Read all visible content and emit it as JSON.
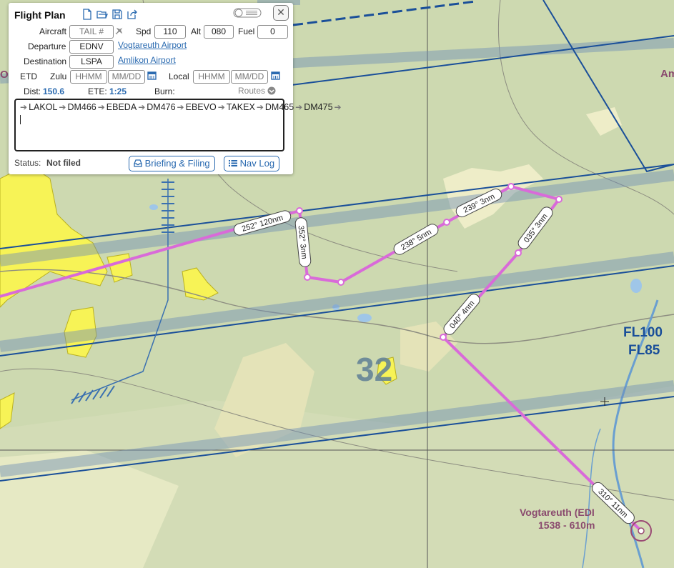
{
  "panel": {
    "title": "Flight Plan",
    "close_glyph": "✕",
    "aircraft_label": "Aircraft",
    "aircraft_placeholder": "TAIL #",
    "spd_label": "Spd",
    "spd_value": "110",
    "alt_label": "Alt",
    "alt_value": "080",
    "fuel_label": "Fuel",
    "fuel_value": "0",
    "departure_label": "Departure",
    "departure_code": "EDNV",
    "departure_name": "Vogtareuth Airport",
    "destination_label": "Destination",
    "destination_code": "LSPA",
    "destination_name": "Amlikon Airport",
    "etd_label": "ETD",
    "zulu_label": "Zulu",
    "time_placeholder": "HHMM",
    "date_placeholder": "MM/DD",
    "local_label": "Local",
    "dist_label": "Dist:",
    "dist_value": "150.6",
    "ete_label": "ETE:",
    "ete_value": "1:25",
    "burn_label": "Burn:",
    "routes_label": "Routes",
    "route_waypoints": [
      "LAKOL",
      "DM466",
      "EBEDA",
      "DM476",
      "EBEVO",
      "TAKEX",
      "DM465",
      "DM475"
    ],
    "status_label": "Status:",
    "status_value": "Not filed",
    "briefing_button": "Briefing & Filing",
    "navlog_button": "Nav Log"
  },
  "map": {
    "route_color": "#d96ad9",
    "airway_color": "#1a4f99",
    "legs": [
      {
        "label": "252° 120nm"
      },
      {
        "label": "352° 3nm"
      },
      {
        "label": "238° 5nm"
      },
      {
        "label": "239° 3nm"
      },
      {
        "label": "035° 3nm"
      },
      {
        "label": "040° 4nm"
      },
      {
        "label": "310° 11nm"
      }
    ],
    "airport_name": "Vogtareuth (EDI",
    "airport_elev": "1538 - 610m",
    "fl_top": "FL100",
    "fl_bottom": "FL85",
    "grid_number": "32",
    "edge_label_right": "Am",
    "edge_label_left": "Ob"
  }
}
